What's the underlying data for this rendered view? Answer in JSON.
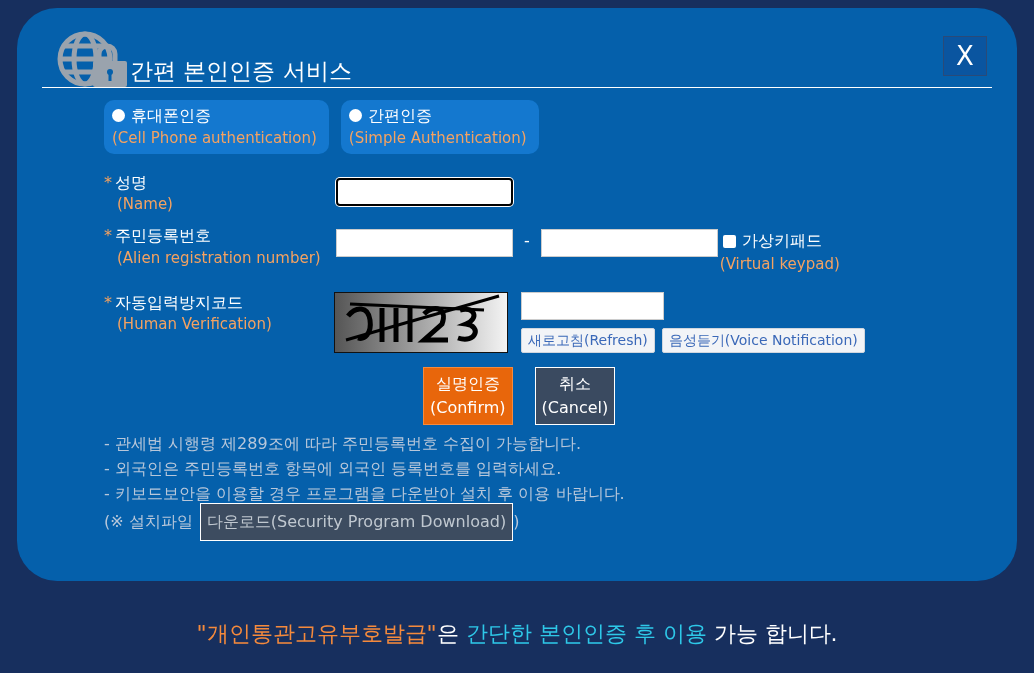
{
  "dialog": {
    "title": "간편 본인인증 서비스",
    "close_label": "X"
  },
  "auth_methods": [
    {
      "label": "휴대폰인증",
      "sublabel": "(Cell Phone authentication)",
      "selected": false
    },
    {
      "label": "간편인증",
      "sublabel": "(Simple Authentication)",
      "selected": false
    }
  ],
  "fields": [
    {
      "kind": "text",
      "mark": "*",
      "label": "성명",
      "sublabel": "(Name)",
      "focused": true
    },
    {
      "kind": "split",
      "mark": "*",
      "label": "주민등록번호",
      "sublabel": "(Alien registration number)",
      "separator": "-",
      "keypad": {
        "label": "가상키패드",
        "sublabel": "(Virtual keypad)",
        "checked": false
      }
    },
    {
      "kind": "captcha",
      "mark": "*",
      "label": "자동입력방지코드",
      "sublabel": "(Human Verification)",
      "buttons": [
        "새로고침(Refresh)",
        "음성듣기(Voice Notification)"
      ]
    }
  ],
  "actions": [
    {
      "kind": "primary",
      "label": "실명인증",
      "sublabel": "(Confirm)"
    },
    {
      "kind": "secondary",
      "label": "취소",
      "sublabel": "(Cancel)"
    }
  ],
  "notes": [
    "- 관세법 시행령 제289조에 따라 주민등록번호 수집이 가능합니다.",
    "- 외국인은 주민등록번호 항목에 외국인 등록번호를 입력하세요.",
    "- 키보드보안을 이용할 경우 프로그램을 다운받아 설치 후 이용 바랍니다."
  ],
  "install": {
    "prefix": "(※ 설치파일",
    "button": "다운로드(Security Program Download)",
    "suffix": ")"
  },
  "footer": {
    "segments": [
      {
        "kind": "quoted",
        "text": "\"개인통관고유부호발급\""
      },
      {
        "kind": "plain",
        "text": "은 "
      },
      {
        "kind": "emphasis",
        "text": "간단한 본인인증 후 이용"
      },
      {
        "kind": "plain",
        "text": " 가능 합니다."
      }
    ]
  }
}
